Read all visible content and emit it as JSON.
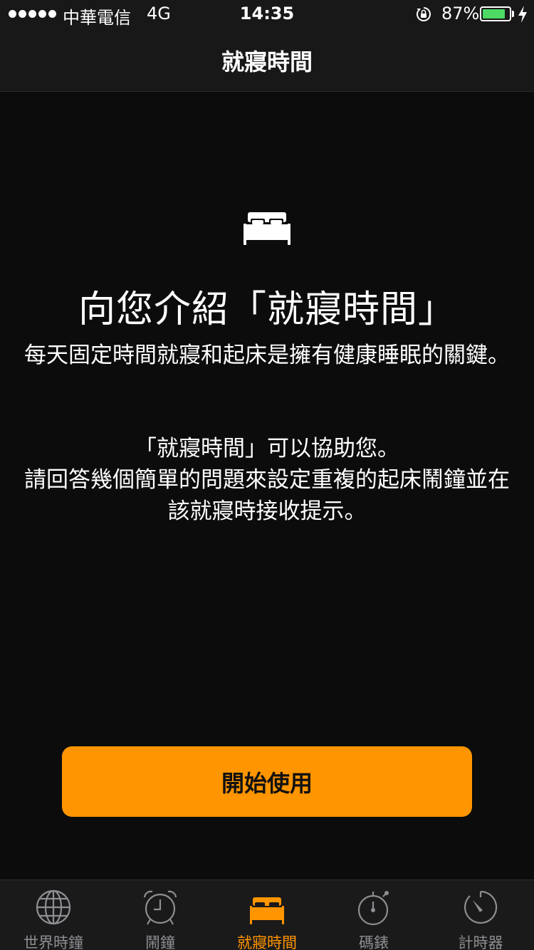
{
  "status_bar": {
    "carrier": "中華電信",
    "network": "4G",
    "time": "14:35",
    "battery_percent": "87%",
    "battery_level": 0.87,
    "signal_icon": "signal-dots-icon",
    "lock_icon": "orientation-lock-icon",
    "charging_icon": "charging-bolt-icon"
  },
  "nav": {
    "title": "就寢時間"
  },
  "content": {
    "hero_icon": "bed-icon",
    "headline": "向您介紹「就寢時間」",
    "paragraph1": "每天固定時間就寢和起床是擁有健康睡眠的關鍵。",
    "paragraph2_line1": "「就寢時間」可以協助您。",
    "paragraph2_line2": "請回答幾個簡單的問題來設定重複的起床鬧鐘並在該就寢時接收提示。"
  },
  "button": {
    "label": "開始使用",
    "color": "#ff9500"
  },
  "tab_bar": {
    "active_color": "#ff9500",
    "inactive_color": "#8e8e93",
    "tabs": [
      {
        "label": "世界時鐘",
        "icon": "globe-icon",
        "active": false
      },
      {
        "label": "鬧鐘",
        "icon": "alarm-clock-icon",
        "active": false
      },
      {
        "label": "就寢時間",
        "icon": "bed-icon",
        "active": true
      },
      {
        "label": "碼錶",
        "icon": "stopwatch-icon",
        "active": false
      },
      {
        "label": "計時器",
        "icon": "timer-icon",
        "active": false
      }
    ]
  }
}
